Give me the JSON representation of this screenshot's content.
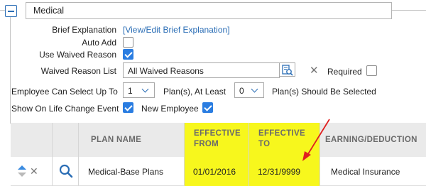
{
  "section": {
    "title": "Medical"
  },
  "form": {
    "brief_explanation_label": "Brief Explanation",
    "brief_explanation_link": "[View/Edit Brief Explanation]",
    "auto_add_label": "Auto Add",
    "auto_add_checked": false,
    "use_waived_reason_label": "Use Waived Reason",
    "use_waived_reason_checked": true,
    "waived_reason_list_label": "Waived Reason List",
    "waived_reason_list_value": "All Waived Reasons",
    "required_label": "Required",
    "required_checked": false,
    "employee_can_select_label": "Employee Can Select Up To",
    "select_up_to_value": "1",
    "plans_at_least_label": "Plan(s), At Least",
    "at_least_value": "0",
    "plans_should_be_selected_label": "Plan(s) Should Be Selected",
    "show_on_life_change_label": "Show On Life Change Event",
    "show_on_life_change_checked": true,
    "new_employee_label": "New Employee",
    "new_employee_checked": true
  },
  "table": {
    "headers": {
      "plan_name": "PLAN NAME",
      "effective_from_line1": "EFFECTIVE",
      "effective_from_line2": "FROM",
      "effective_to_line1": "EFFECTIVE",
      "effective_to_line2": "TO",
      "earning_deduction": "EARNING/DEDUCTION"
    },
    "rows": [
      {
        "plan_name": "Medical-Base Plans",
        "effective_from": "01/01/2016",
        "effective_to": "12/31/9999",
        "earning_deduction": "Medical Insurance"
      }
    ]
  },
  "colors": {
    "accent": "#2a6db5",
    "checkbox": "#2a7de1",
    "highlight": "#f7f71d",
    "annotation_arrow": "#e02020"
  },
  "icons": [
    "collapse-icon",
    "search-icon",
    "clear-icon",
    "sort-icon",
    "remove-icon",
    "magnifier-icon",
    "chevron-down-icon",
    "annotation-arrow"
  ]
}
